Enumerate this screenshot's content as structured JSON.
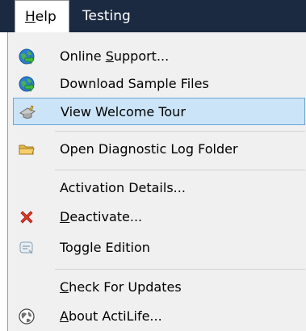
{
  "menubar": {
    "help": {
      "label_pre": "",
      "label_mnemonic": "H",
      "label_post": "elp"
    },
    "testing": {
      "label": "Testing"
    }
  },
  "menu": {
    "online_support": {
      "pre": "Online ",
      "mk": "S",
      "post": "upport..."
    },
    "download_samples": {
      "label": "Download Sample Files"
    },
    "welcome_tour": {
      "label": "View Welcome Tour"
    },
    "diag_folder": {
      "label": "Open Diagnostic Log Folder"
    },
    "activation": {
      "label": "Activation Details..."
    },
    "deactivate": {
      "pre": "",
      "mk": "D",
      "post": "eactivate..."
    },
    "toggle_edition": {
      "label": "Toggle Edition"
    },
    "check_updates": {
      "pre": "",
      "mk": "C",
      "post": "heck For Updates"
    },
    "about": {
      "pre": "",
      "mk": "A",
      "post": "bout ActiLife..."
    }
  },
  "colors": {
    "menubar_bg": "#1b2a41",
    "highlight_bg": "#cce4f7",
    "highlight_border": "#6aa6d8"
  },
  "icons": {
    "online_support": "globe-green-arrow-icon",
    "download_samples": "globe-green-arrow-icon",
    "welcome_tour": "graduation-cap-icon",
    "diag_folder": "folder-icon",
    "deactivate": "red-x-icon",
    "toggle_edition": "toggle-icon",
    "about": "globe-info-icon"
  }
}
